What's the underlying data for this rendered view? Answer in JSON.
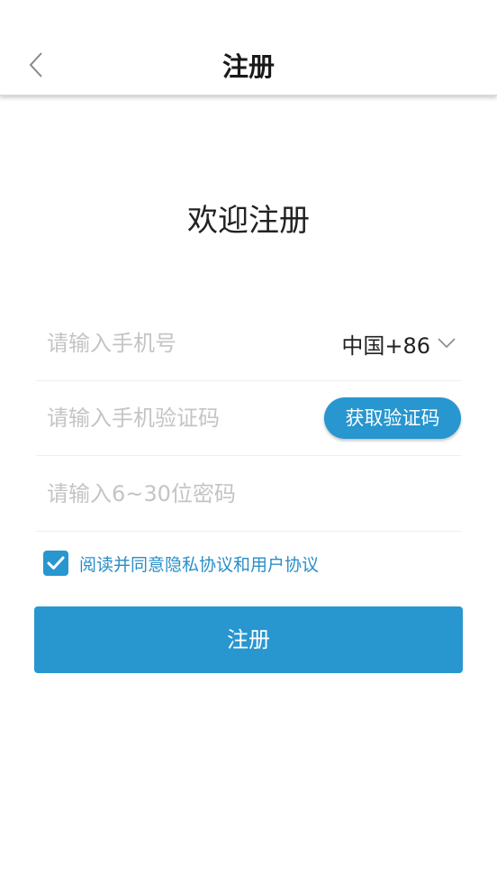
{
  "header": {
    "title": "注册",
    "back_icon": "chevron-left-icon"
  },
  "welcome": "欢迎注册",
  "form": {
    "phone_placeholder": "请输入手机号",
    "country_code": "中国+86",
    "code_placeholder": "请输入手机验证码",
    "get_code_label": "获取验证码",
    "password_placeholder": "请输入6~30位密码"
  },
  "agreement": {
    "checked": true,
    "text": "阅读并同意隐私协议和用户协议"
  },
  "submit_label": "注册",
  "colors": {
    "accent": "#2896cf",
    "link": "#2a8ec8"
  }
}
